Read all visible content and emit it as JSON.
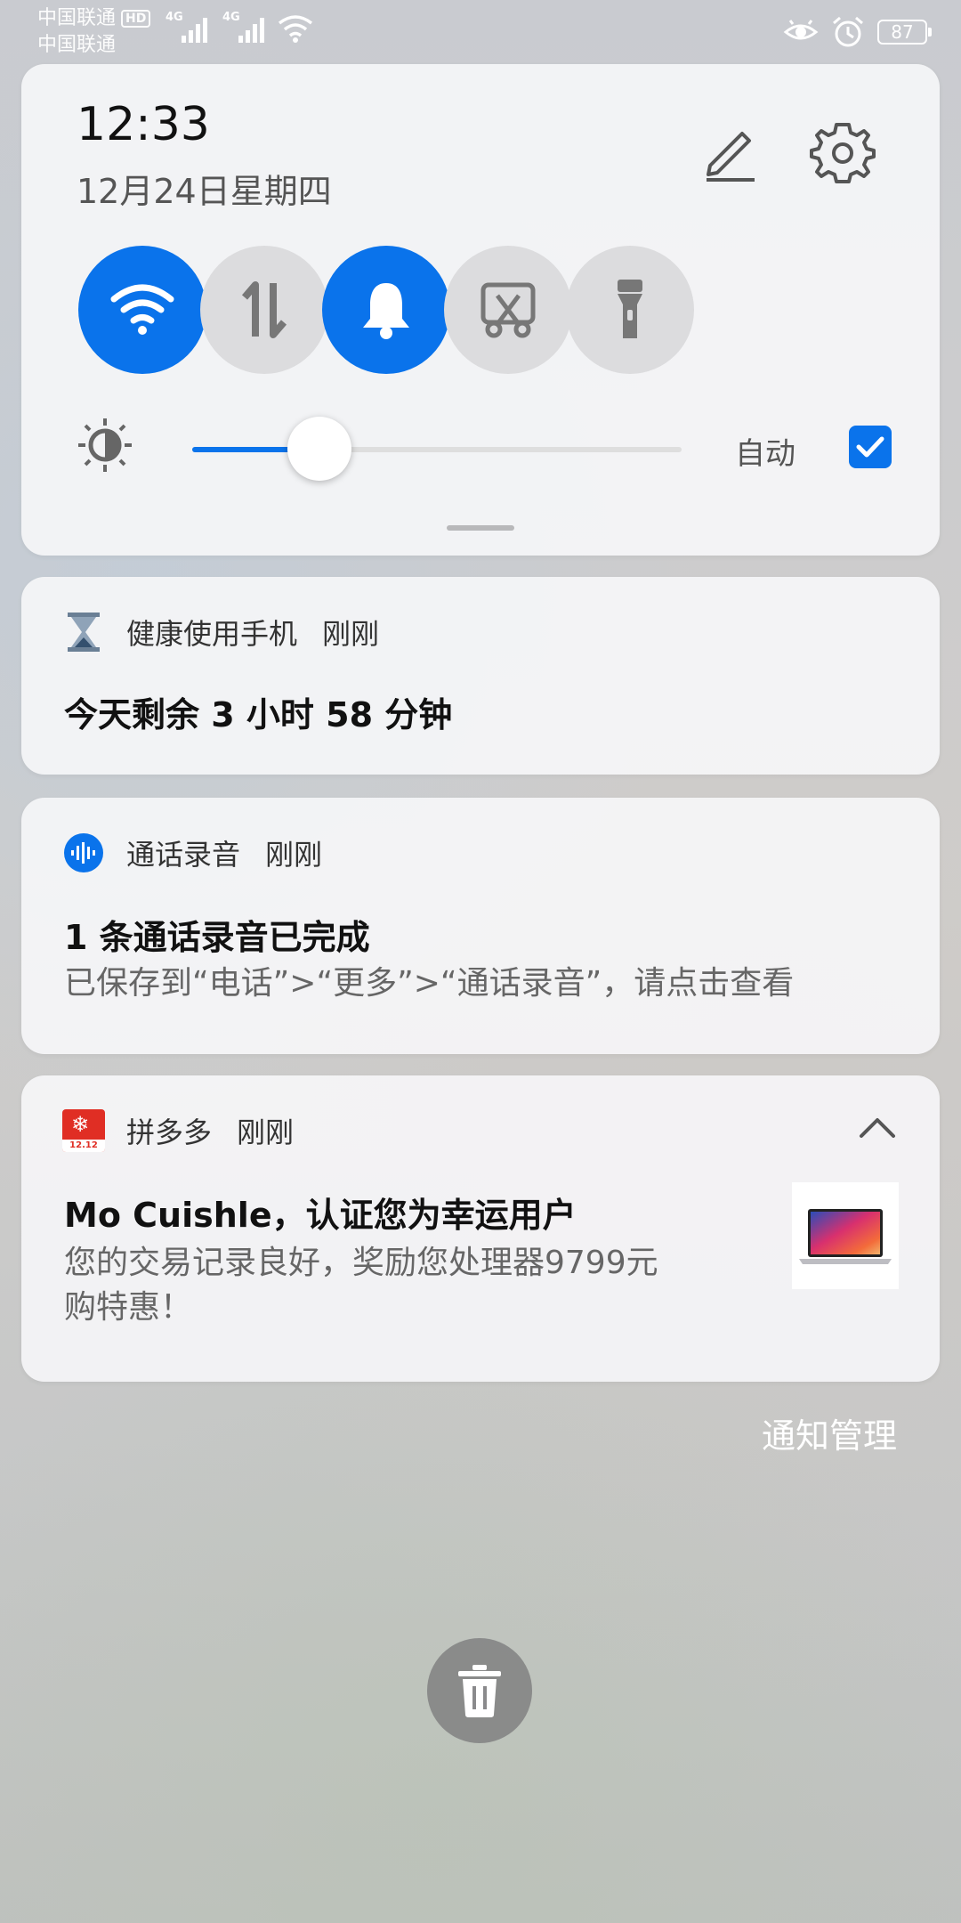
{
  "status_bar": {
    "carrier_1": "中国联通",
    "carrier_2": "中国联通",
    "hd_badge": "HD",
    "network_1": "4G",
    "network_2": "4G",
    "battery": "87",
    "icons": [
      "signal-icon",
      "wifi-icon",
      "eye-comfort-icon",
      "alarm-icon",
      "battery-icon"
    ]
  },
  "quick_settings": {
    "time": "12:33",
    "date": "12月24日星期四",
    "toggles": [
      {
        "name": "wifi",
        "on": true
      },
      {
        "name": "mobile-data",
        "on": false
      },
      {
        "name": "sound",
        "on": true
      },
      {
        "name": "screenshot",
        "on": false
      },
      {
        "name": "flashlight",
        "on": false
      }
    ],
    "brightness_level": 0.26,
    "auto_label": "自动",
    "auto_checked": true,
    "accent_color": "#0a73eb"
  },
  "notifications": [
    {
      "app": "健康使用手机",
      "time": "刚刚",
      "title": "今天剩余 3 小时 58 分钟"
    },
    {
      "app": "通话录音",
      "time": "刚刚",
      "title": "1 条通话录音已完成",
      "body": "已保存到“电话”>“更多”>“通话录音”，请点击查看"
    },
    {
      "app": "拼多多",
      "time": "刚刚",
      "title": "Mo Cuishle，认证您为幸运用户",
      "body_line1": "您的交易记录良好，奖励您处理器9799元",
      "body_line2": "购特惠！",
      "icon_badge": "12.12"
    }
  ],
  "footer": {
    "manage_label": "通知管理"
  }
}
